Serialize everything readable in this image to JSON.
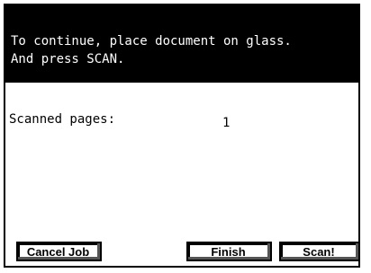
{
  "message": {
    "line1": "To continue, place document on glass.",
    "line2": "And press SCAN."
  },
  "scan_status": {
    "label": "Scanned pages:",
    "count": "1"
  },
  "buttons": {
    "cancel_label": "Cancel Job",
    "finish_label": "Finish",
    "scan_label": "Scan!"
  }
}
